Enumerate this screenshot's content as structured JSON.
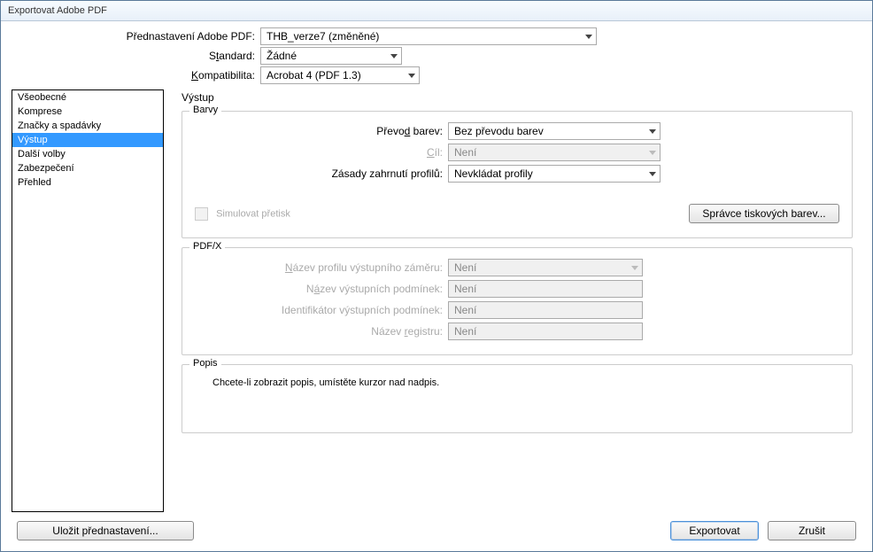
{
  "window": {
    "title": "Exportovat Adobe PDF"
  },
  "top": {
    "preset_label": "Přednastavení Adobe PDF:",
    "preset_value": "THB_verze7 (změněné)",
    "standard_label_pre": "S",
    "standard_label_u": "t",
    "standard_label_post": "andard:",
    "standard_value": "Žádné",
    "compat_label_u": "K",
    "compat_label_post": "ompatibilita:",
    "compat_value": "Acrobat 4 (PDF 1.3)"
  },
  "sidebar": {
    "items": [
      {
        "label": "Všeobecné",
        "selected": false
      },
      {
        "label": "Komprese",
        "selected": false
      },
      {
        "label": "Značky a spadávky",
        "selected": false
      },
      {
        "label": "Výstup",
        "selected": true
      },
      {
        "label": "Další volby",
        "selected": false
      },
      {
        "label": "Zabezpečení",
        "selected": false
      },
      {
        "label": "Přehled",
        "selected": false
      }
    ]
  },
  "panel": {
    "title": "Výstup",
    "barvy": {
      "legend": "Barvy",
      "prevod_label_pre": "Převo",
      "prevod_label_u": "d",
      "prevod_label_post": " barev:",
      "prevod_value": "Bez převodu barev",
      "cil_label_u": "C",
      "cil_label_post": "íl:",
      "cil_value": "Není",
      "zasady_label": "Zásady zahrnutí profilů:",
      "zasady_value": "Nevkládat profily",
      "simulovat_label": "Simulovat přetisk",
      "spravce_btn": "Správce tiskových barev..."
    },
    "pdfx": {
      "legend": "PDF/X",
      "npvz_pre": "",
      "npvz_u": "N",
      "npvz_post": "ázev profilu výstupního záměru:",
      "npvz_value": "Není",
      "nvp_pre": "N",
      "nvp_u": "á",
      "nvp_post": "zev výstupních podmínek:",
      "nvp_value": "Není",
      "ivp_label": "Identifikátor výstupních podmínek:",
      "ivp_value": "Není",
      "nr_pre": "Název ",
      "nr_u": "r",
      "nr_post": "egistru:",
      "nr_value": "Není"
    },
    "popis": {
      "legend": "Popis",
      "text": "Chcete-li zobrazit popis, umístěte kurzor nad nadpis."
    }
  },
  "footer": {
    "save_preset": "Uložit přednastavení...",
    "export": "Exportovat",
    "cancel": "Zrušit"
  }
}
